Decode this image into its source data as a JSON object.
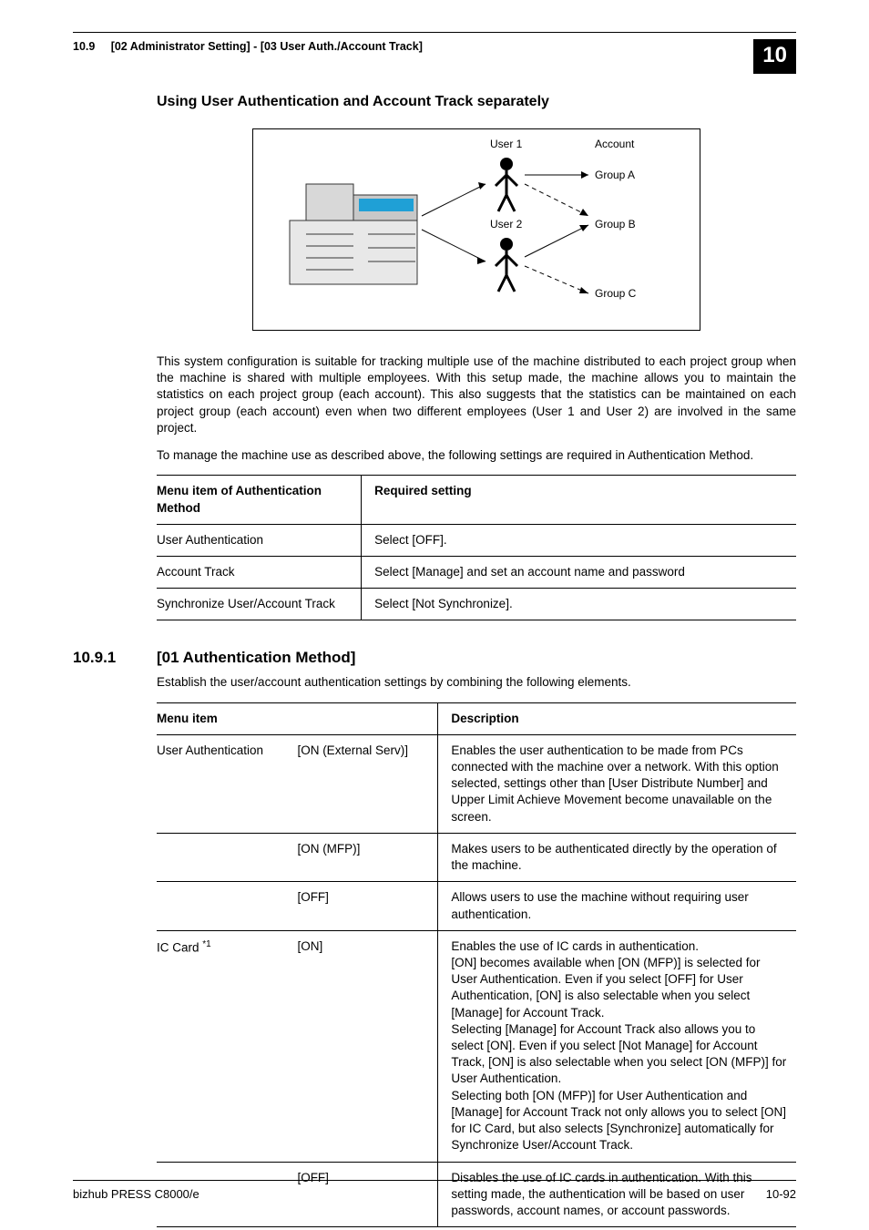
{
  "header": {
    "left": "10.9     [02 Administrator Setting] - [03 User Auth./Account Track]",
    "chapter": "10"
  },
  "subheading": "Using User Authentication and Account Track separately",
  "diagram": {
    "user1": "User 1",
    "user2": "User 2",
    "account": "Account",
    "groupA": "Group A",
    "groupB": "Group B",
    "groupC": "Group C"
  },
  "paras": {
    "p1": "This system configuration is suitable for tracking multiple use of the machine distributed to each project group when the machine is shared with multiple employees. With this setup made, the machine allows you to maintain the statistics on each project group (each account). This also suggests that the statistics can be maintained on each project group (each account) even when two different employees (User 1 and User 2) are involved in the same project.",
    "p2": "To manage the machine use as described above, the following settings are required in Authentication Method."
  },
  "table1": {
    "h1": "Menu item of Authentication Method",
    "h2": "Required setting",
    "rows": [
      {
        "a": "User Authentication",
        "b": "Select [OFF]."
      },
      {
        "a": "Account Track",
        "b": "Select [Manage] and set an account name and password"
      },
      {
        "a": "Synchronize User/Account Track",
        "b": "Select [Not Synchronize]."
      }
    ]
  },
  "section": {
    "num": "10.9.1",
    "title": "[01 Authentication Method]",
    "intro": "Establish the user/account authentication settings by combining the following elements."
  },
  "table2": {
    "h1": "Menu item",
    "h2": "Description",
    "r1": {
      "name": "User Authentication",
      "opt": "[ON (External Serv)]",
      "desc": "Enables the user authentication to be made from PCs connected with the machine over a network. With this option selected, settings other than [User Distribute Number] and Upper Limit Achieve Movement become unavailable on the screen."
    },
    "r2": {
      "opt": "[ON (MFP)]",
      "desc": "Makes users to be authenticated directly by the operation of the machine."
    },
    "r3": {
      "opt": "[OFF]",
      "desc": "Allows users to use the machine without requiring user authentication."
    },
    "r4": {
      "name_pre": "IC Card ",
      "name_sup": "*1",
      "opt": "[ON]",
      "desc": "Enables the use of IC cards in authentication.\n[ON] becomes available when [ON (MFP)] is selected for User Authentication. Even if you select [OFF] for User Authentication, [ON] is also selectable when you select [Manage] for Account Track.\nSelecting [Manage] for Account Track also allows you to select [ON]. Even if you select [Not Manage] for Account Track, [ON] is also selectable when you select [ON (MFP)] for User Authentication.\nSelecting both [ON (MFP)] for User Authentication and [Manage] for Account Track not only allows you to select [ON] for IC Card, but also selects [Synchronize] automatically for Synchronize User/Account Track."
    },
    "r5": {
      "opt": "[OFF]",
      "desc": "Disables the use of IC cards in authentication. With this setting made, the authentication will be based on user passwords, account names, or account passwords."
    }
  },
  "footer": {
    "left": "bizhub PRESS C8000/e",
    "right": "10-92"
  }
}
